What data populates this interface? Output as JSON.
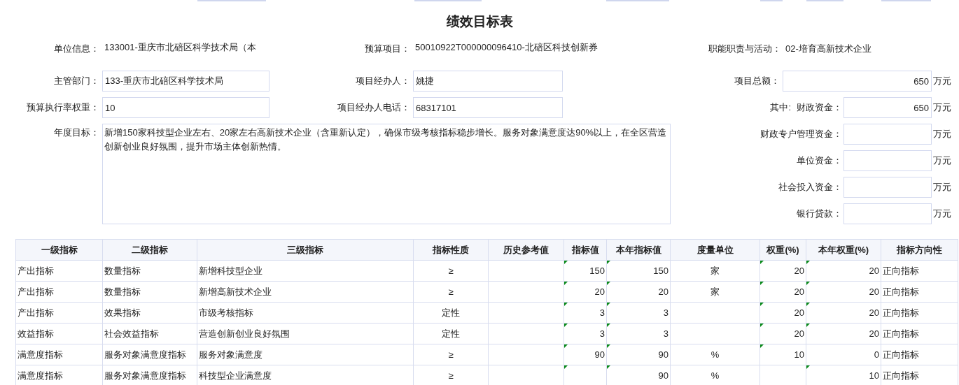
{
  "title": "绩效目标表",
  "unit_info": {
    "label": "单位信息：",
    "value": "133001-重庆市北碚区科学技术局（本"
  },
  "budget_project": {
    "label": "预算项目：",
    "value": "50010922T000000096410-北碚区科技创新券"
  },
  "duty_activity": {
    "label": "职能职责与活动：",
    "value": "02-培育高新技术企业"
  },
  "fields": [
    {
      "label": "主管部门：",
      "value": "133-重庆市北碚区科学技术局"
    },
    {
      "label": "项目经办人：",
      "value": "姚捷"
    },
    {
      "label": "预算执行率权重：",
      "value": "10"
    },
    {
      "label": "项目经办人电话：",
      "value": "68317101"
    }
  ],
  "annual_goal": {
    "label": "年度目标：",
    "value": "新增150家科技型企业左右、20家左右高新技术企业（含重新认定），确保市级考核指标稳步增长。服务对象满意度达90%以上，在全区营造创新创业良好氛围，提升市场主体创新热情。"
  },
  "total": {
    "label": "项目总额：",
    "value": "650",
    "unit": "万元"
  },
  "funds_prefix": "其中:",
  "funds": [
    {
      "label": "财政资金：",
      "value": "650",
      "unit": "万元"
    },
    {
      "label": "财政专户管理资金：",
      "unit": "万元"
    },
    {
      "label": "单位资金：",
      "unit": "万元"
    },
    {
      "label": "社会投入资金：",
      "unit": "万元"
    },
    {
      "label": "银行贷款：",
      "unit": "万元"
    }
  ],
  "table": {
    "columns": [
      "一级指标",
      "二级指标",
      "三级指标",
      "指标性质",
      "历史参考值",
      "指标值",
      "本年指标值",
      "度量单位",
      "权重(%)",
      "本年权重(%)",
      "指标方向性"
    ],
    "rows": [
      {
        "cells": [
          "产出指标",
          "数量指标",
          "新增科技型企业",
          "≥",
          null,
          "150",
          "150",
          "家",
          "20",
          "20",
          "正向指标"
        ],
        "marked": [
          false,
          false,
          false,
          false,
          false,
          true,
          true,
          false,
          true,
          true,
          false
        ]
      },
      {
        "cells": [
          "产出指标",
          "数量指标",
          "新增高新技术企业",
          "≥",
          null,
          "20",
          "20",
          "家",
          "20",
          "20",
          "正向指标"
        ],
        "marked": [
          false,
          false,
          false,
          false,
          false,
          true,
          true,
          false,
          true,
          true,
          false
        ]
      },
      {
        "cells": [
          "产出指标",
          "效果指标",
          "市级考核指标",
          "定性",
          null,
          "3",
          "3",
          null,
          "20",
          "20",
          "正向指标"
        ],
        "marked": [
          false,
          false,
          false,
          false,
          false,
          true,
          true,
          false,
          true,
          true,
          false
        ]
      },
      {
        "cells": [
          "效益指标",
          "社会效益指标",
          "营造创新创业良好氛围",
          "定性",
          null,
          "3",
          "3",
          null,
          "20",
          "20",
          "正向指标"
        ],
        "marked": [
          false,
          false,
          false,
          false,
          false,
          true,
          true,
          false,
          true,
          true,
          false
        ]
      },
      {
        "cells": [
          "满意度指标",
          "服务对象满意度指标",
          "服务对象满意度",
          "≥",
          null,
          "90",
          "90",
          "%",
          "10",
          "0",
          "正向指标"
        ],
        "marked": [
          false,
          false,
          false,
          false,
          false,
          true,
          true,
          false,
          true,
          false,
          false
        ]
      },
      {
        "cells": [
          "满意度指标",
          "服务对象满意度指标",
          "科技型企业满意度",
          "≥",
          null,
          null,
          "90",
          "%",
          null,
          "10",
          "正向指标"
        ],
        "marked": [
          false,
          false,
          false,
          false,
          false,
          true,
          true,
          false,
          false,
          true,
          false
        ]
      }
    ]
  }
}
